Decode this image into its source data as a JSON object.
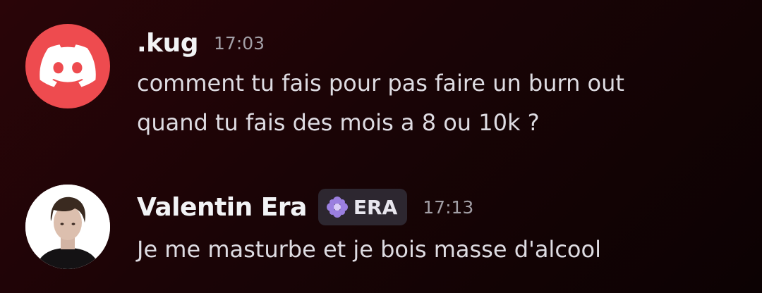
{
  "messages": [
    {
      "username": ".kug",
      "timestamp": "17:03",
      "avatar": "discord-logo-icon",
      "avatar_color": "#ee4b4f",
      "lines": [
        "comment tu fais pour pas faire un burn out",
        "quand tu fais des mois a 8 ou 10k ?"
      ]
    },
    {
      "username": "Valentin Era",
      "role_tag": {
        "icon": "purple-flower-icon",
        "label": "ERA",
        "color": "#9b7fe0"
      },
      "timestamp": "17:13",
      "avatar": "user-photo",
      "lines": [
        "Je me masturbe et je bois masse d'alcool"
      ]
    }
  ]
}
